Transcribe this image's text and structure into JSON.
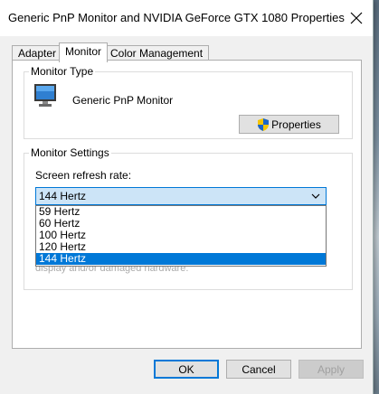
{
  "window": {
    "title": "Generic PnP Monitor and NVIDIA GeForce GTX 1080 Properties"
  },
  "tabs": [
    {
      "label": "Adapter"
    },
    {
      "label": "Monitor"
    },
    {
      "label": "Color Management"
    }
  ],
  "monitor_type": {
    "heading": "Monitor Type",
    "monitor_name": "Generic PnP Monitor",
    "properties_label": "Properties"
  },
  "monitor_settings": {
    "heading": "Monitor Settings",
    "refresh_label": "Screen refresh rate:",
    "refresh_value": "144 Hertz",
    "options": [
      "59 Hertz",
      "60 Hertz",
      "100 Hertz",
      "120 Hertz",
      "144 Hertz"
    ],
    "partial_warning": "display and/or damaged hardware."
  },
  "buttons": {
    "ok": "OK",
    "cancel": "Cancel",
    "apply": "Apply"
  },
  "colors": {
    "accent": "#0078d7",
    "select_bg": "#cce4f7"
  }
}
